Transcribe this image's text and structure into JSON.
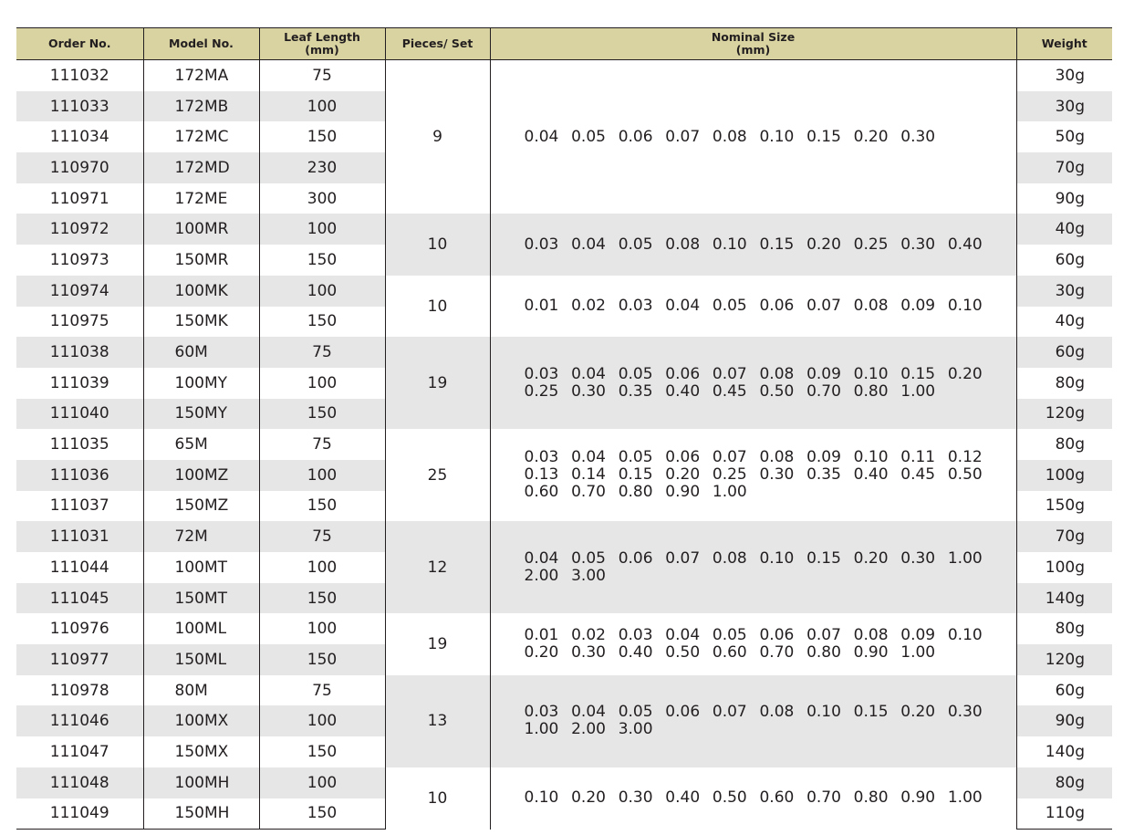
{
  "headers": {
    "order_no": "Order No.",
    "model_no": "Model No.",
    "leaf_length_line1": "Leaf Length",
    "leaf_length_line2": "(mm)",
    "pieces": "Pieces/ Set",
    "nominal_line1": "Nominal Size",
    "nominal_line2": "(mm)",
    "weight": "Weight"
  },
  "groups": [
    {
      "pieces": "9",
      "sizes": [
        [
          "0.04",
          "0.05",
          "0.06",
          "0.07",
          "0.08",
          "0.10",
          "0.15",
          "0.20",
          "0.30"
        ]
      ],
      "rows": [
        {
          "order": "111032",
          "model": "172MA",
          "length": "75",
          "weight": "30g"
        },
        {
          "order": "111033",
          "model": "172MB",
          "length": "100",
          "weight": "30g"
        },
        {
          "order": "111034",
          "model": "172MC",
          "length": "150",
          "weight": "50g"
        },
        {
          "order": "110970",
          "model": "172MD",
          "length": "230",
          "weight": "70g"
        },
        {
          "order": "110971",
          "model": "172ME",
          "length": "300",
          "weight": "90g"
        }
      ]
    },
    {
      "pieces": "10",
      "sizes": [
        [
          "0.03",
          "0.04",
          "0.05",
          "0.08",
          "0.10",
          "0.15",
          "0.20",
          "0.25",
          "0.30",
          "0.40"
        ]
      ],
      "rows": [
        {
          "order": "110972",
          "model": "100MR",
          "length": "100",
          "weight": "40g"
        },
        {
          "order": "110973",
          "model": "150MR",
          "length": "150",
          "weight": "60g"
        }
      ]
    },
    {
      "pieces": "10",
      "sizes": [
        [
          "0.01",
          "0.02",
          "0.03",
          "0.04",
          "0.05",
          "0.06",
          "0.07",
          "0.08",
          "0.09",
          "0.10"
        ]
      ],
      "rows": [
        {
          "order": "110974",
          "model": "100MK",
          "length": "100",
          "weight": "30g"
        },
        {
          "order": "110975",
          "model": "150MK",
          "length": "150",
          "weight": "40g"
        }
      ]
    },
    {
      "pieces": "19",
      "sizes": [
        [
          "0.03",
          "0.04",
          "0.05",
          "0.06",
          "0.07",
          "0.08",
          "0.09",
          "0.10",
          "0.15",
          "0.20"
        ],
        [
          "0.25",
          "0.30",
          "0.35",
          "0.40",
          "0.45",
          "0.50",
          "0.70",
          "0.80",
          "1.00"
        ]
      ],
      "rows": [
        {
          "order": "111038",
          "model": "60M",
          "length": "75",
          "weight": "60g"
        },
        {
          "order": "111039",
          "model": "100MY",
          "length": "100",
          "weight": "80g"
        },
        {
          "order": "111040",
          "model": "150MY",
          "length": "150",
          "weight": "120g"
        }
      ]
    },
    {
      "pieces": "25",
      "sizes": [
        [
          "0.03",
          "0.04",
          "0.05",
          "0.06",
          "0.07",
          "0.08",
          "0.09",
          "0.10",
          "0.11",
          "0.12"
        ],
        [
          "0.13",
          "0.14",
          "0.15",
          "0.20",
          "0.25",
          "0.30",
          "0.35",
          "0.40",
          "0.45",
          "0.50"
        ],
        [
          "0.60",
          "0.70",
          "0.80",
          "0.90",
          "1.00"
        ]
      ],
      "rows": [
        {
          "order": "111035",
          "model": "65M",
          "length": "75",
          "weight": "80g"
        },
        {
          "order": "111036",
          "model": "100MZ",
          "length": "100",
          "weight": "100g"
        },
        {
          "order": "111037",
          "model": "150MZ",
          "length": "150",
          "weight": "150g"
        }
      ]
    },
    {
      "pieces": "12",
      "sizes": [
        [
          "0.04",
          "0.05",
          "0.06",
          "0.07",
          "0.08",
          "0.10",
          "0.15",
          "0.20",
          "0.30",
          "1.00"
        ],
        [
          "2.00",
          "3.00"
        ]
      ],
      "rows": [
        {
          "order": "111031",
          "model": "72M",
          "length": "75",
          "weight": "70g"
        },
        {
          "order": "111044",
          "model": "100MT",
          "length": "100",
          "weight": "100g"
        },
        {
          "order": "111045",
          "model": "150MT",
          "length": "150",
          "weight": "140g"
        }
      ]
    },
    {
      "pieces": "19",
      "sizes": [
        [
          "0.01",
          "0.02",
          "0.03",
          "0.04",
          "0.05",
          "0.06",
          "0.07",
          "0.08",
          "0.09",
          "0.10"
        ],
        [
          "0.20",
          "0.30",
          "0.40",
          "0.50",
          "0.60",
          "0.70",
          "0.80",
          "0.90",
          "1.00"
        ]
      ],
      "rows": [
        {
          "order": "110976",
          "model": "100ML",
          "length": "100",
          "weight": "80g"
        },
        {
          "order": "110977",
          "model": "150ML",
          "length": "150",
          "weight": "120g"
        }
      ]
    },
    {
      "pieces": "13",
      "sizes": [
        [
          "0.03",
          "0.04",
          "0.05",
          "0.06",
          "0.07",
          "0.08",
          "0.10",
          "0.15",
          "0.20",
          "0.30"
        ],
        [
          "1.00",
          "2.00",
          "3.00"
        ]
      ],
      "rows": [
        {
          "order": "110978",
          "model": "80M",
          "length": "75",
          "weight": "60g"
        },
        {
          "order": "111046",
          "model": "100MX",
          "length": "100",
          "weight": "90g"
        },
        {
          "order": "111047",
          "model": "150MX",
          "length": "150",
          "weight": "140g"
        }
      ]
    },
    {
      "pieces": "10",
      "sizes": [
        [
          "0.10",
          "0.20",
          "0.30",
          "0.40",
          "0.50",
          "0.60",
          "0.70",
          "0.80",
          "0.90",
          "1.00"
        ]
      ],
      "rows": [
        {
          "order": "111048",
          "model": "100MH",
          "length": "100",
          "weight": "80g"
        },
        {
          "order": "111049",
          "model": "150MH",
          "length": "150",
          "weight": "110g"
        }
      ]
    }
  ]
}
